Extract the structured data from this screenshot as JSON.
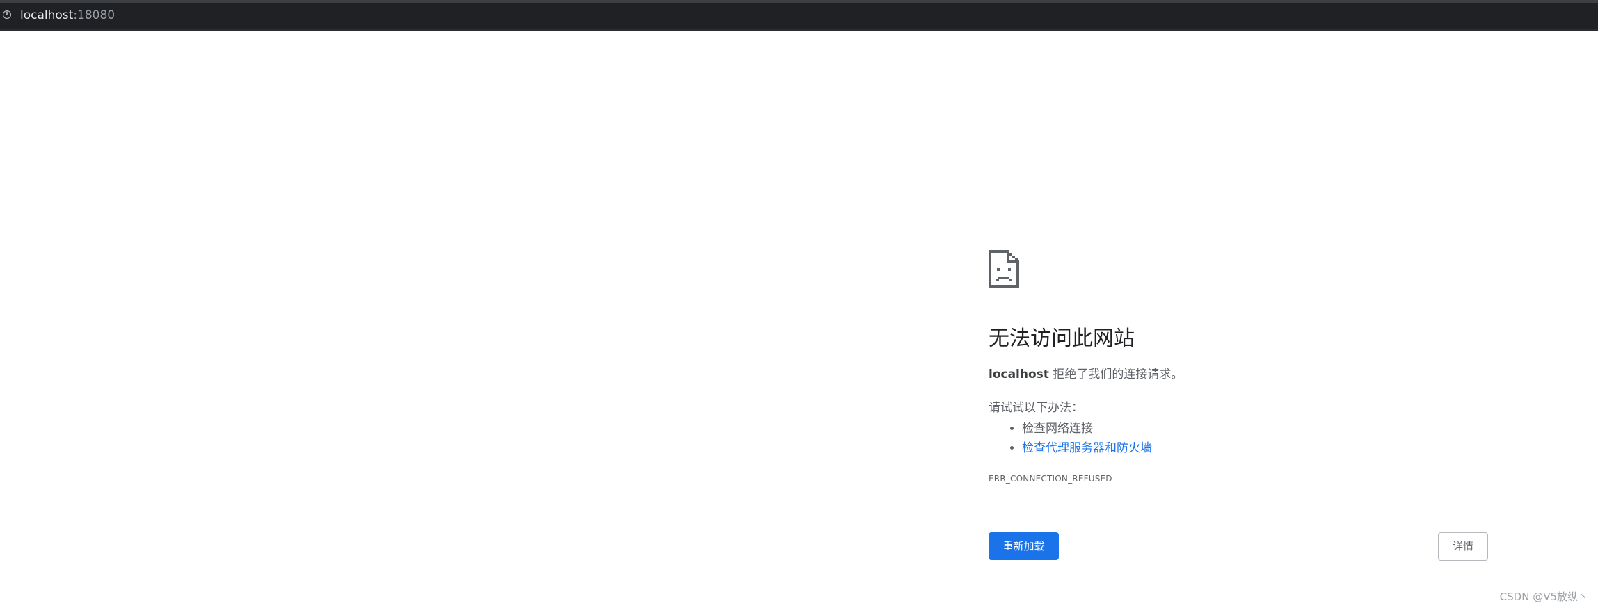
{
  "address_bar": {
    "info_icon": "info-circle-icon",
    "host": "localhost",
    "port": ":18080"
  },
  "error_page": {
    "icon": "sad-document-icon",
    "title": "无法访问此网站",
    "host_bold": "localhost",
    "description_rest": " 拒绝了我们的连接请求。",
    "suggestions_heading": "请试试以下办法：",
    "suggestions": [
      {
        "text": "检查网络连接",
        "is_link": false
      },
      {
        "text": "检查代理服务器和防火墙",
        "is_link": true
      }
    ],
    "error_code": "ERR_CONNECTION_REFUSED",
    "reload_label": "重新加载",
    "details_label": "详情"
  },
  "watermark": "CSDN @V5放纵丶",
  "colors": {
    "topbar": "#202124",
    "primary_button": "#1a73e8",
    "link": "#1a73e8",
    "text_secondary": "#5f6368"
  }
}
